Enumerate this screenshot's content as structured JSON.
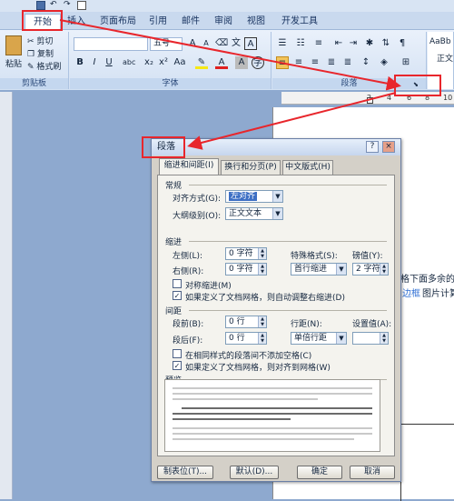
{
  "ribbon": {
    "tabs": [
      "开始",
      "插入",
      "页面布局",
      "引用",
      "邮件",
      "审阅",
      "视图",
      "开发工具"
    ],
    "clipboard": {
      "paste": "粘贴",
      "cut": "剪切",
      "copy": "复制",
      "format_painter": "格式刷",
      "group": "剪贴板"
    },
    "font": {
      "size": "五号",
      "group": "字体"
    },
    "paragraph": {
      "group": "段落"
    },
    "styles": {
      "sample": "AaBb",
      "name": "正文"
    }
  },
  "ruler_numbers": [
    "2",
    "4",
    "6",
    "8",
    "10"
  ],
  "page_text": {
    "line1": "格下面多余的",
    "line2a": "边框",
    "line2b": "图片计算"
  },
  "dialog": {
    "title": "段落",
    "help": "?",
    "close": "×",
    "tabs": [
      "缩进和间距(I)",
      "换行和分页(P)",
      "中文版式(H)"
    ],
    "general": {
      "header": "常规",
      "align_label": "对齐方式(G):",
      "align_value": "左对齐",
      "outline_label": "大纲级别(O):",
      "outline_value": "正文文本"
    },
    "indent": {
      "header": "缩进",
      "left_label": "左侧(L):",
      "left_value": "0 字符",
      "right_label": "右侧(R):",
      "right_value": "0 字符",
      "special_label": "特殊格式(S):",
      "special_value": "首行缩进",
      "by_label": "磅值(Y):",
      "by_value": "2 字符",
      "mirror": "对称缩进(M)",
      "auto_adjust": "如果定义了文档网格，则自动调整右缩进(D)"
    },
    "spacing": {
      "header": "间距",
      "before_label": "段前(B):",
      "before_value": "0 行",
      "after_label": "段后(F):",
      "after_value": "0 行",
      "line_label": "行距(N):",
      "line_value": "单倍行距",
      "at_label": "设置值(A):",
      "at_value": "",
      "no_space": "在相同样式的段落间不添加空格(C)",
      "snap_grid": "如果定义了文档网格，则对齐到网格(W)"
    },
    "preview": {
      "header": "预览"
    },
    "buttons": {
      "tabs": "制表位(T)...",
      "default": "默认(D)...",
      "ok": "确定",
      "cancel": "取消"
    }
  },
  "colors": {
    "annotation": "#e8262c",
    "selected_align": "#3d6fc4"
  }
}
